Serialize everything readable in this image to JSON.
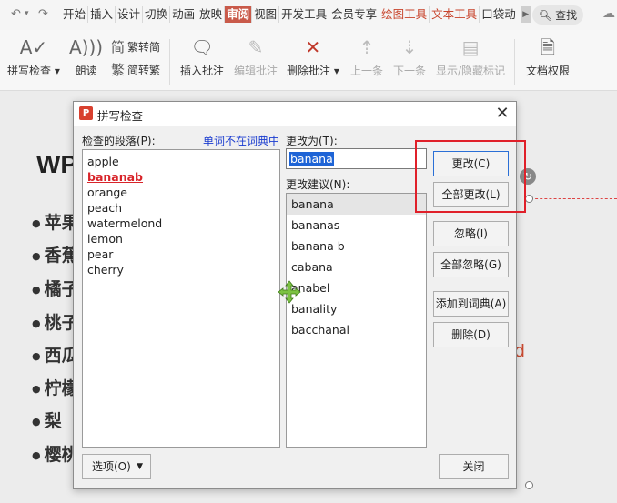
{
  "ribbon": {
    "quick_icons": [
      "undo-icon",
      "redo-icon"
    ],
    "tabs": [
      {
        "label": "开始"
      },
      {
        "label": "插入"
      },
      {
        "label": "设计"
      },
      {
        "label": "切换"
      },
      {
        "label": "动画"
      },
      {
        "label": "放映"
      },
      {
        "label": "审阅"
      },
      {
        "label": "视图"
      },
      {
        "label": "开发工具"
      },
      {
        "label": "会员专享"
      },
      {
        "label": "绘图工具"
      },
      {
        "label": "文本工具"
      },
      {
        "label": "口袋动"
      }
    ],
    "active_tab": "审阅",
    "search_label": "查找",
    "tools": {
      "spellcheck": "拼写检查",
      "read_aloud": "朗读",
      "trad_to_simp": "繁转简",
      "simp_to_trad": "简转繁",
      "insert_comment": "插入批注",
      "edit_comment": "编辑批注",
      "delete_comment": "删除批注",
      "previous": "上一条",
      "next": "下一条",
      "show_hide_markup": "显示/隐藏标记",
      "doc_permissions": "文档权限"
    },
    "colors": {
      "active_tab_bg": "#c95a4a",
      "accent_tab_text": "#c8442c"
    }
  },
  "slide": {
    "title": "WP",
    "bullets": [
      "苹果",
      "香蕉",
      "橘子",
      "桃子",
      "西瓜",
      "柠檬",
      "梨",
      "樱桃"
    ],
    "partial_text": "d"
  },
  "dialog": {
    "title": "拼写检查",
    "paragraph_label": "检查的段落(P):",
    "not_in_dict_label": "单词不在词典中",
    "paragraph_lines": [
      "apple",
      "bananab",
      "orange",
      "peach",
      "watermelond",
      "lemon",
      "pear",
      "cherry"
    ],
    "error_word": "bananab",
    "change_to_label": "更改为(T):",
    "change_to_value": "banana",
    "suggestions_label": "更改建议(N):",
    "suggestions": [
      "banana",
      "bananas",
      "banana b",
      "cabana",
      "anabel",
      "banality",
      "bacchanal"
    ],
    "selected_suggestion": "banana",
    "buttons": {
      "change": "更改(C)",
      "change_all": "全部更改(L)",
      "ignore": "忽略(I)",
      "ignore_all": "全部忽略(G)",
      "add_to_dict": "添加到词典(A)",
      "delete": "删除(D)",
      "options": "选项(O)",
      "close": "关闭"
    },
    "colors": {
      "error_text": "#d8242a",
      "link_text": "#1a3ccf",
      "highlight_border": "#e0202a",
      "selection": "#1e64d6"
    }
  }
}
